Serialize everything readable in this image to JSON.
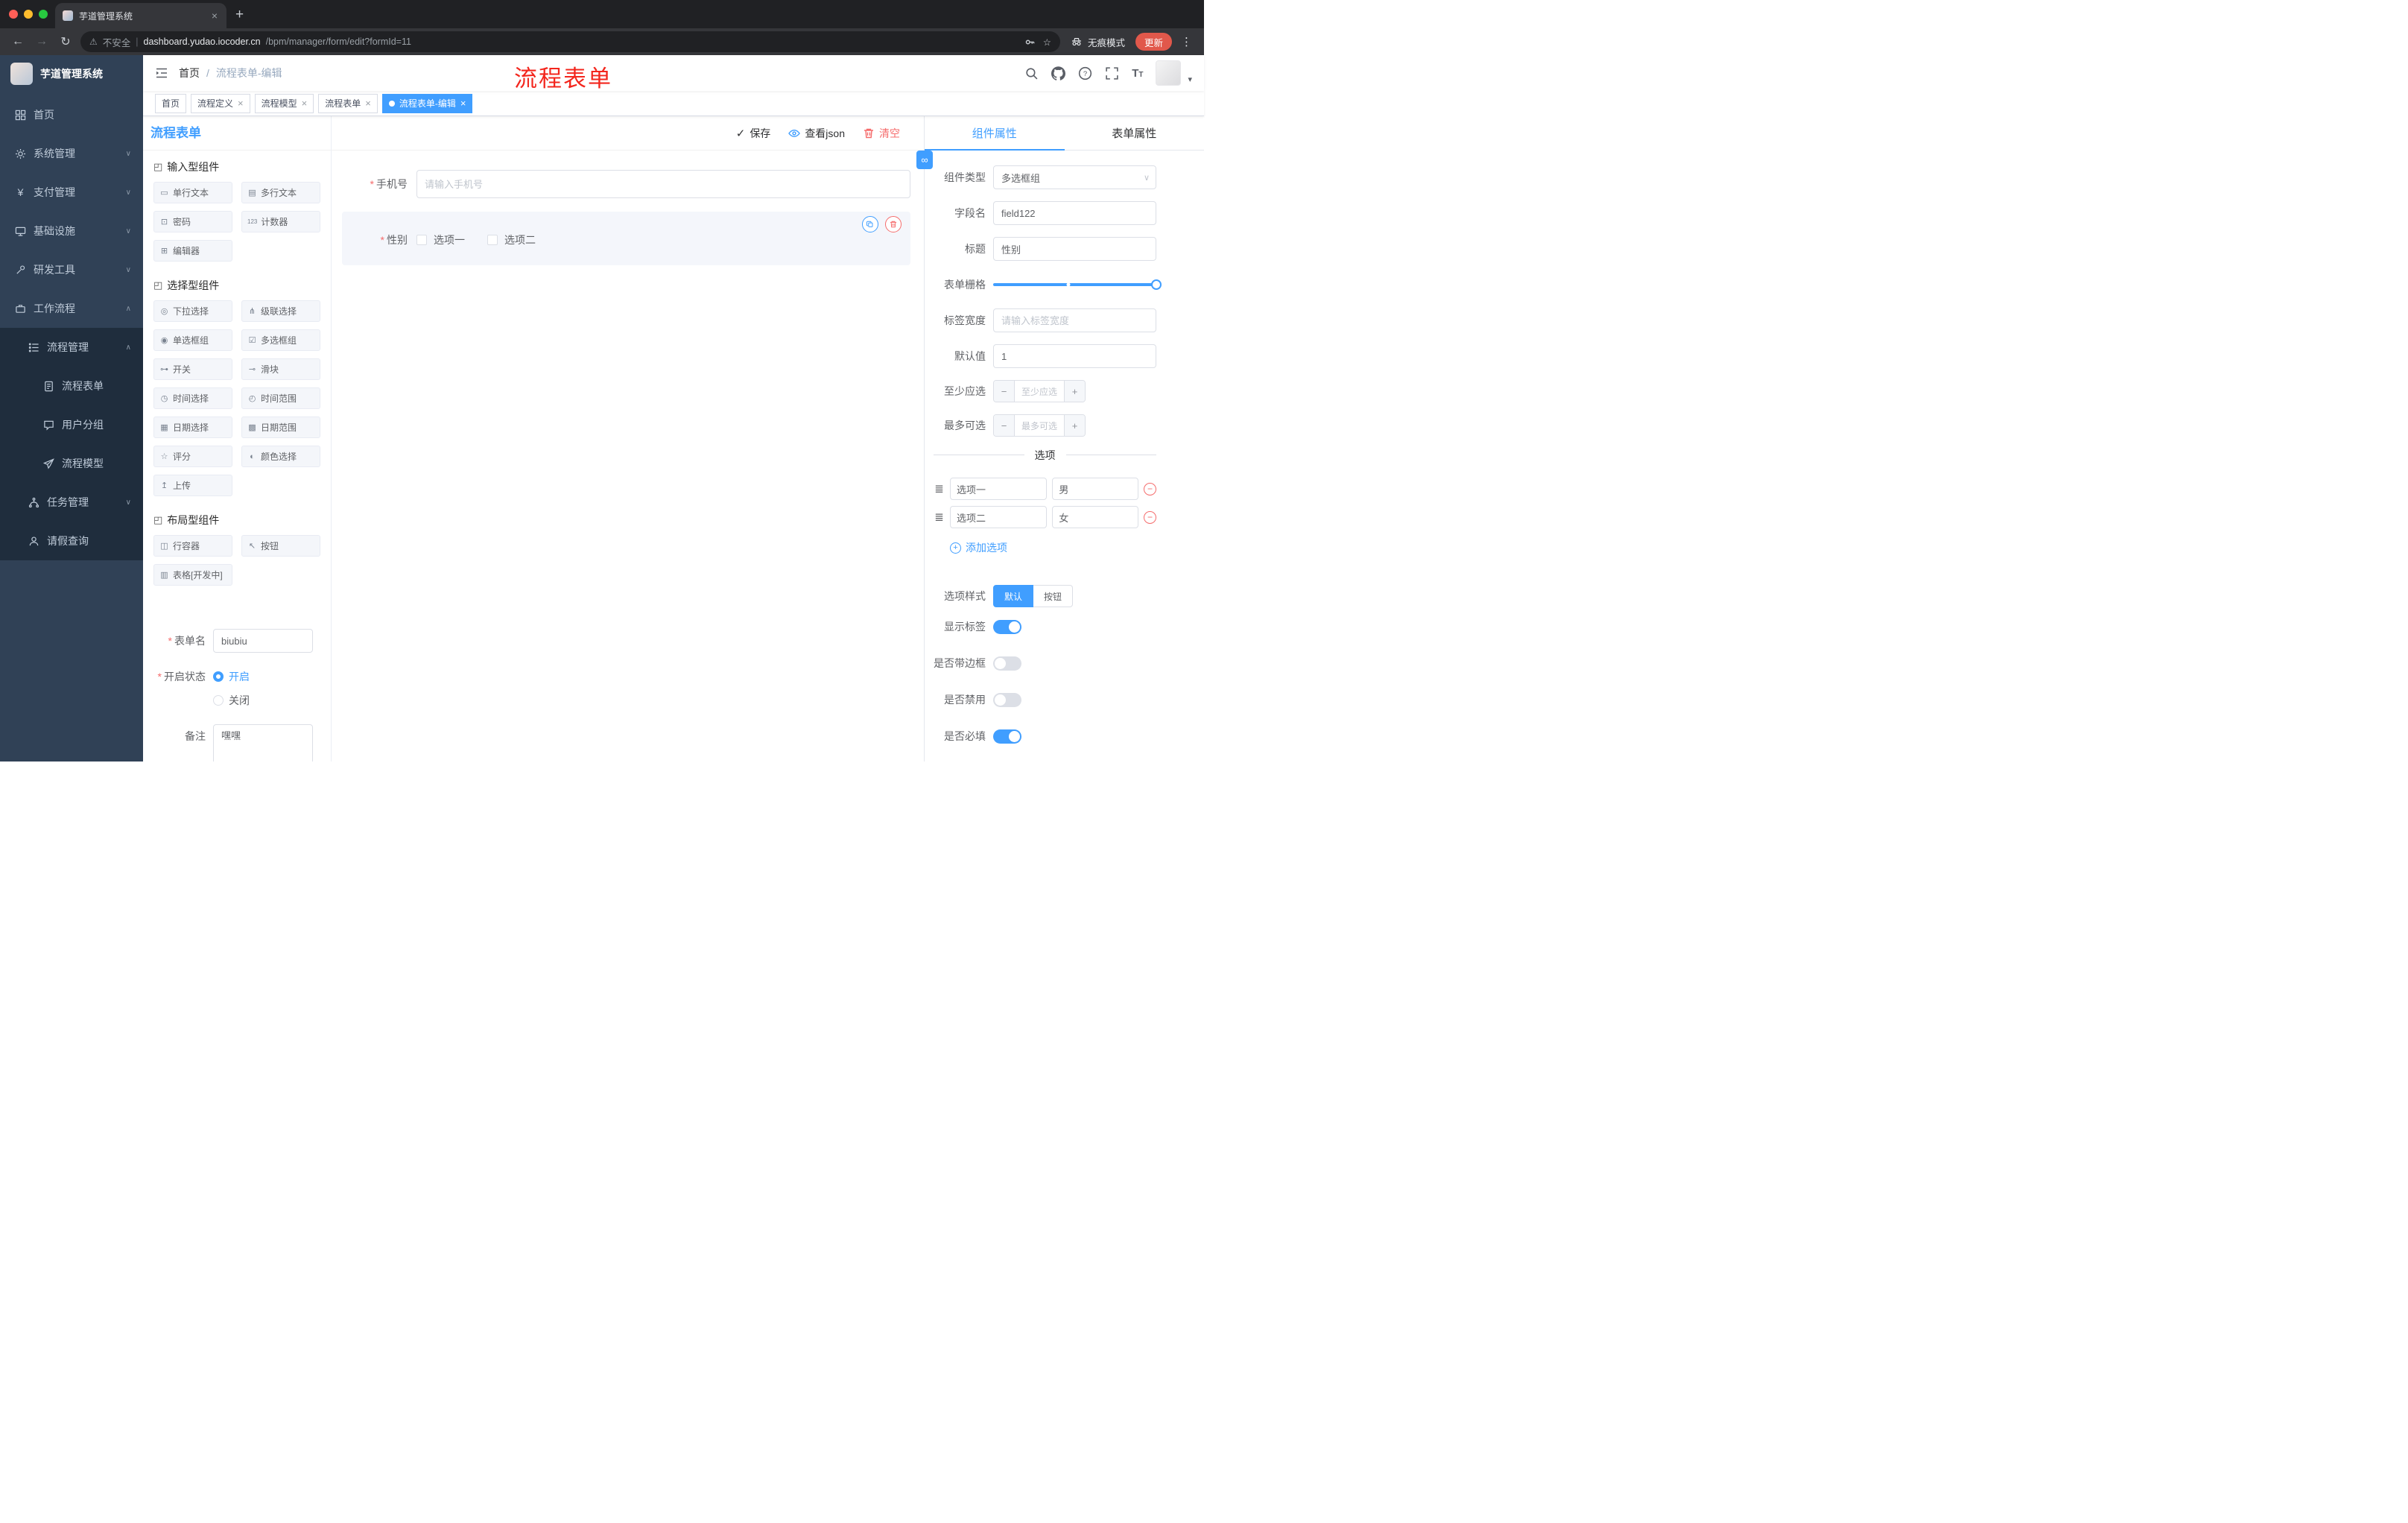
{
  "browser": {
    "tab_title": "芋道管理系统",
    "security_label": "不安全",
    "url_host": "dashboard.yudao.iocoder.cn",
    "url_path": "/bpm/manager/form/edit?formId=11",
    "incognito_label": "无痕模式",
    "update_label": "更新"
  },
  "sidebar": {
    "logo_title": "芋道管理系统",
    "menu": [
      {
        "label": "首页"
      },
      {
        "label": "系统管理"
      },
      {
        "label": "支付管理"
      },
      {
        "label": "基础设施"
      },
      {
        "label": "研发工具"
      },
      {
        "label": "工作流程"
      },
      {
        "label": "流程管理"
      },
      {
        "label": "流程表单"
      },
      {
        "label": "用户分组"
      },
      {
        "label": "流程模型"
      },
      {
        "label": "任务管理"
      },
      {
        "label": "请假查询"
      }
    ]
  },
  "navbar": {
    "breadcrumb_home": "首页",
    "breadcrumb_current": "流程表单-编辑",
    "annotation": "流程表单"
  },
  "tags": [
    {
      "label": "首页"
    },
    {
      "label": "流程定义"
    },
    {
      "label": "流程模型"
    },
    {
      "label": "流程表单"
    },
    {
      "label": "流程表单-编辑"
    }
  ],
  "editor": {
    "page_title": "流程表单",
    "actions": {
      "save": "保存",
      "view_json": "查看json",
      "clear": "清空"
    },
    "palette": {
      "sections": [
        {
          "title": "输入型组件",
          "icon": "◰",
          "items": [
            {
              "icon": "▭",
              "label": "单行文本"
            },
            {
              "icon": "▤",
              "label": "多行文本"
            },
            {
              "icon": "⊡",
              "label": "密码"
            },
            {
              "icon": "123",
              "label": "计数器"
            },
            {
              "icon": "⊞",
              "label": "编辑器"
            }
          ]
        },
        {
          "title": "选择型组件",
          "icon": "◰",
          "items": [
            {
              "icon": "◎",
              "label": "下拉选择"
            },
            {
              "icon": "⋔",
              "label": "级联选择"
            },
            {
              "icon": "◉",
              "label": "单选框组"
            },
            {
              "icon": "☑",
              "label": "多选框组"
            },
            {
              "icon": "⊶",
              "label": "开关"
            },
            {
              "icon": "⊸",
              "label": "滑块"
            },
            {
              "icon": "◷",
              "label": "时间选择"
            },
            {
              "icon": "◴",
              "label": "时间范围"
            },
            {
              "icon": "▦",
              "label": "日期选择"
            },
            {
              "icon": "▩",
              "label": "日期范围"
            },
            {
              "icon": "☆",
              "label": "评分"
            },
            {
              "icon": "◐",
              "label": "颜色选择"
            },
            {
              "icon": "↥",
              "label": "上传"
            }
          ]
        },
        {
          "title": "布局型组件",
          "icon": "◰",
          "items": [
            {
              "icon": "◫",
              "label": "行容器"
            },
            {
              "icon": "↖",
              "label": "按钮"
            },
            {
              "icon": "▥",
              "label": "表格[开发中]"
            }
          ]
        }
      ],
      "form": {
        "name_label": "表单名",
        "name_value": "biubiu",
        "status_label": "开启状态",
        "status_on": "开启",
        "status_off": "关闭",
        "remark_label": "备注",
        "remark_value": "嘿嘿"
      }
    },
    "canvas": {
      "phone_label": "手机号",
      "phone_placeholder": "请输入手机号",
      "gender_label": "性别",
      "gender_option1": "选项一",
      "gender_option2": "选项二"
    },
    "props": {
      "tab_component": "组件属性",
      "tab_form": "表单属性",
      "component_type_label": "组件类型",
      "component_type_value": "多选框组",
      "field_name_label": "字段名",
      "field_name_value": "field122",
      "title_label": "标题",
      "title_value": "性别",
      "grid_label": "表单栅格",
      "label_width_label": "标签宽度",
      "label_width_placeholder": "请输入标签宽度",
      "default_label": "默认值",
      "default_value": "1",
      "min_label": "至少应选",
      "min_placeholder": "至少应选",
      "max_label": "最多可选",
      "max_placeholder": "最多可选",
      "options_title": "选项",
      "options": [
        {
          "label": "选项一",
          "value": "男"
        },
        {
          "label": "选项二",
          "value": "女"
        }
      ],
      "add_option": "添加选项",
      "option_style_label": "选项样式",
      "style_default": "默认",
      "style_button": "按钮",
      "show_label_label": "显示标签",
      "border_label": "是否带边框",
      "disabled_label": "是否禁用",
      "required_label": "是否必填"
    }
  },
  "icons": {
    "back": "←",
    "forward": "→",
    "reload": "↻",
    "warning": "⚠",
    "pipe": "|",
    "star": "☆",
    "kebab": "⋮",
    "new_tab": "+",
    "close": "×",
    "chevron_down": "∨",
    "chevron_up": "∧",
    "caret_down": "▾",
    "check": "✓",
    "minus": "−",
    "plus": "+",
    "handle": "≣",
    "link": "∞",
    "yen": "¥",
    "question": "?"
  },
  "colors": {
    "primary": "#409eff",
    "danger": "#f56c6c",
    "sidebar": "#304156",
    "submenu": "#1f2d3d"
  }
}
